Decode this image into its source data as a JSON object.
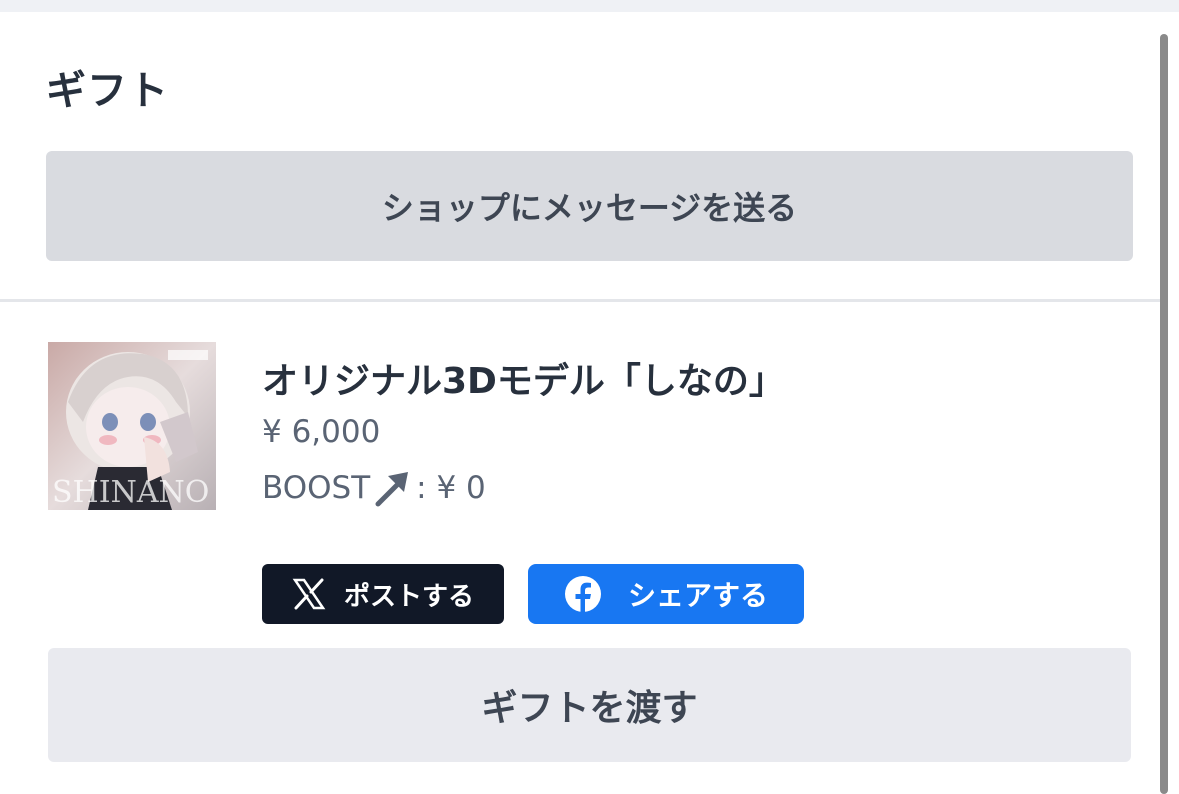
{
  "section": {
    "title": "ギフト"
  },
  "message_button": {
    "label": "ショップにメッセージを送る"
  },
  "product": {
    "name": "オリジナル3Dモデル「しなの」",
    "price": "¥ 6,000",
    "boost_label": "BOOST",
    "boost_value": ": ¥ 0",
    "thumbnail_text": "SHINANO"
  },
  "share": {
    "x_label": "ポストする",
    "facebook_label": "シェアする",
    "x_icon": "x-logo-icon",
    "facebook_icon": "facebook-logo-icon",
    "x_color": "#111827",
    "facebook_color": "#1877f2"
  },
  "gift_button": {
    "label": "ギフトを渡す"
  }
}
